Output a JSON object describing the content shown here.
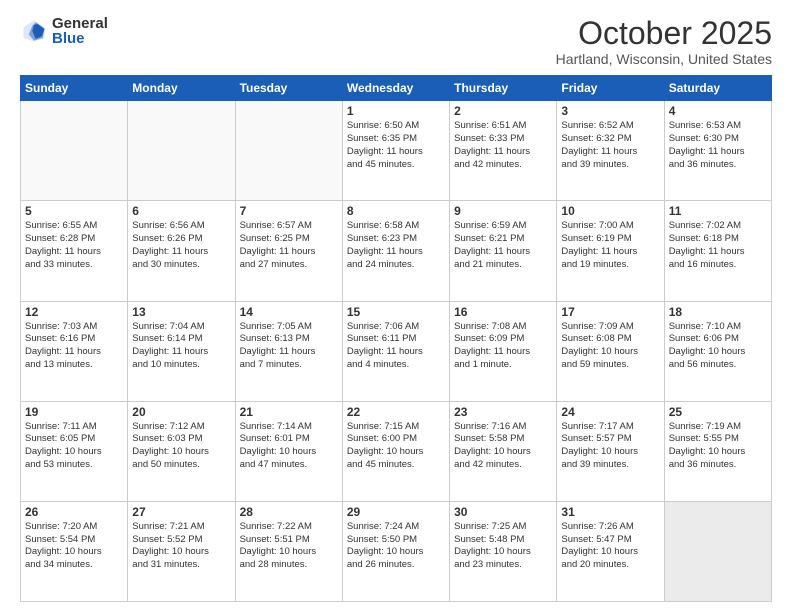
{
  "header": {
    "logo_general": "General",
    "logo_blue": "Blue",
    "month_title": "October 2025",
    "location": "Hartland, Wisconsin, United States"
  },
  "days_of_week": [
    "Sunday",
    "Monday",
    "Tuesday",
    "Wednesday",
    "Thursday",
    "Friday",
    "Saturday"
  ],
  "weeks": [
    [
      {
        "day": "",
        "info": "",
        "empty": true
      },
      {
        "day": "",
        "info": "",
        "empty": true
      },
      {
        "day": "",
        "info": "",
        "empty": true
      },
      {
        "day": "1",
        "info": "Sunrise: 6:50 AM\nSunset: 6:35 PM\nDaylight: 11 hours\nand 45 minutes.",
        "empty": false
      },
      {
        "day": "2",
        "info": "Sunrise: 6:51 AM\nSunset: 6:33 PM\nDaylight: 11 hours\nand 42 minutes.",
        "empty": false
      },
      {
        "day": "3",
        "info": "Sunrise: 6:52 AM\nSunset: 6:32 PM\nDaylight: 11 hours\nand 39 minutes.",
        "empty": false
      },
      {
        "day": "4",
        "info": "Sunrise: 6:53 AM\nSunset: 6:30 PM\nDaylight: 11 hours\nand 36 minutes.",
        "empty": false
      }
    ],
    [
      {
        "day": "5",
        "info": "Sunrise: 6:55 AM\nSunset: 6:28 PM\nDaylight: 11 hours\nand 33 minutes.",
        "empty": false
      },
      {
        "day": "6",
        "info": "Sunrise: 6:56 AM\nSunset: 6:26 PM\nDaylight: 11 hours\nand 30 minutes.",
        "empty": false
      },
      {
        "day": "7",
        "info": "Sunrise: 6:57 AM\nSunset: 6:25 PM\nDaylight: 11 hours\nand 27 minutes.",
        "empty": false
      },
      {
        "day": "8",
        "info": "Sunrise: 6:58 AM\nSunset: 6:23 PM\nDaylight: 11 hours\nand 24 minutes.",
        "empty": false
      },
      {
        "day": "9",
        "info": "Sunrise: 6:59 AM\nSunset: 6:21 PM\nDaylight: 11 hours\nand 21 minutes.",
        "empty": false
      },
      {
        "day": "10",
        "info": "Sunrise: 7:00 AM\nSunset: 6:19 PM\nDaylight: 11 hours\nand 19 minutes.",
        "empty": false
      },
      {
        "day": "11",
        "info": "Sunrise: 7:02 AM\nSunset: 6:18 PM\nDaylight: 11 hours\nand 16 minutes.",
        "empty": false
      }
    ],
    [
      {
        "day": "12",
        "info": "Sunrise: 7:03 AM\nSunset: 6:16 PM\nDaylight: 11 hours\nand 13 minutes.",
        "empty": false
      },
      {
        "day": "13",
        "info": "Sunrise: 7:04 AM\nSunset: 6:14 PM\nDaylight: 11 hours\nand 10 minutes.",
        "empty": false
      },
      {
        "day": "14",
        "info": "Sunrise: 7:05 AM\nSunset: 6:13 PM\nDaylight: 11 hours\nand 7 minutes.",
        "empty": false
      },
      {
        "day": "15",
        "info": "Sunrise: 7:06 AM\nSunset: 6:11 PM\nDaylight: 11 hours\nand 4 minutes.",
        "empty": false
      },
      {
        "day": "16",
        "info": "Sunrise: 7:08 AM\nSunset: 6:09 PM\nDaylight: 11 hours\nand 1 minute.",
        "empty": false
      },
      {
        "day": "17",
        "info": "Sunrise: 7:09 AM\nSunset: 6:08 PM\nDaylight: 10 hours\nand 59 minutes.",
        "empty": false
      },
      {
        "day": "18",
        "info": "Sunrise: 7:10 AM\nSunset: 6:06 PM\nDaylight: 10 hours\nand 56 minutes.",
        "empty": false
      }
    ],
    [
      {
        "day": "19",
        "info": "Sunrise: 7:11 AM\nSunset: 6:05 PM\nDaylight: 10 hours\nand 53 minutes.",
        "empty": false
      },
      {
        "day": "20",
        "info": "Sunrise: 7:12 AM\nSunset: 6:03 PM\nDaylight: 10 hours\nand 50 minutes.",
        "empty": false
      },
      {
        "day": "21",
        "info": "Sunrise: 7:14 AM\nSunset: 6:01 PM\nDaylight: 10 hours\nand 47 minutes.",
        "empty": false
      },
      {
        "day": "22",
        "info": "Sunrise: 7:15 AM\nSunset: 6:00 PM\nDaylight: 10 hours\nand 45 minutes.",
        "empty": false
      },
      {
        "day": "23",
        "info": "Sunrise: 7:16 AM\nSunset: 5:58 PM\nDaylight: 10 hours\nand 42 minutes.",
        "empty": false
      },
      {
        "day": "24",
        "info": "Sunrise: 7:17 AM\nSunset: 5:57 PM\nDaylight: 10 hours\nand 39 minutes.",
        "empty": false
      },
      {
        "day": "25",
        "info": "Sunrise: 7:19 AM\nSunset: 5:55 PM\nDaylight: 10 hours\nand 36 minutes.",
        "empty": false
      }
    ],
    [
      {
        "day": "26",
        "info": "Sunrise: 7:20 AM\nSunset: 5:54 PM\nDaylight: 10 hours\nand 34 minutes.",
        "empty": false
      },
      {
        "day": "27",
        "info": "Sunrise: 7:21 AM\nSunset: 5:52 PM\nDaylight: 10 hours\nand 31 minutes.",
        "empty": false
      },
      {
        "day": "28",
        "info": "Sunrise: 7:22 AM\nSunset: 5:51 PM\nDaylight: 10 hours\nand 28 minutes.",
        "empty": false
      },
      {
        "day": "29",
        "info": "Sunrise: 7:24 AM\nSunset: 5:50 PM\nDaylight: 10 hours\nand 26 minutes.",
        "empty": false
      },
      {
        "day": "30",
        "info": "Sunrise: 7:25 AM\nSunset: 5:48 PM\nDaylight: 10 hours\nand 23 minutes.",
        "empty": false
      },
      {
        "day": "31",
        "info": "Sunrise: 7:26 AM\nSunset: 5:47 PM\nDaylight: 10 hours\nand 20 minutes.",
        "empty": false
      },
      {
        "day": "",
        "info": "",
        "empty": true
      }
    ]
  ]
}
